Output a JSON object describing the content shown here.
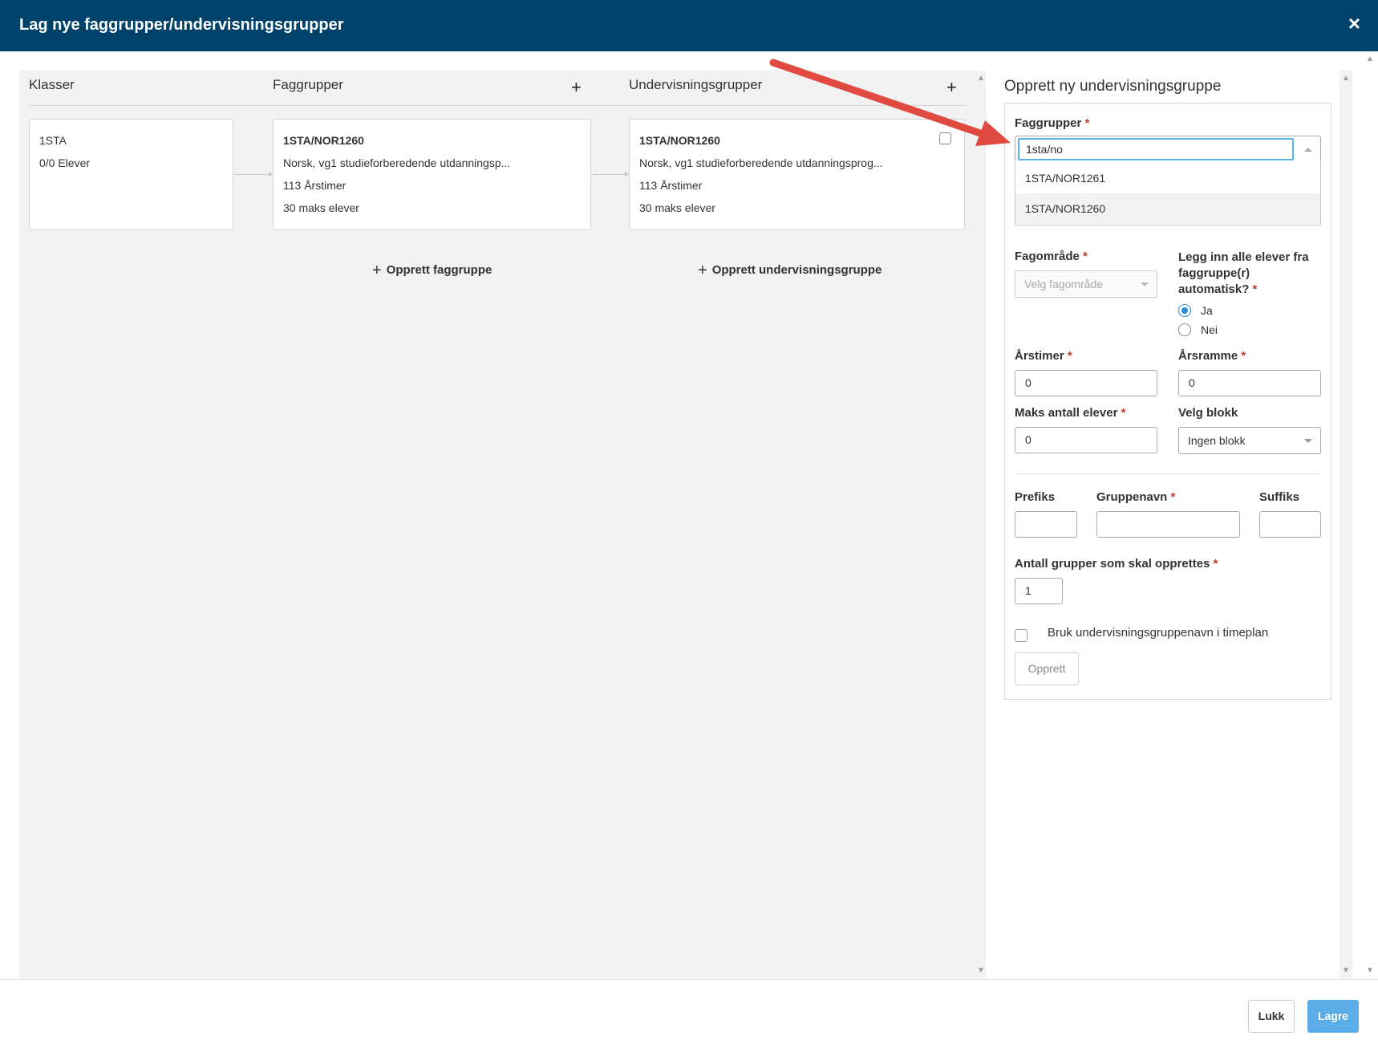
{
  "dialog": {
    "title": "Lag nye faggrupper/undervisningsgrupper",
    "close_label": "×"
  },
  "columns": {
    "klasser": {
      "header": "Klasser"
    },
    "faggrupper": {
      "header": "Faggrupper",
      "plus": "+"
    },
    "undervisningsgrupper": {
      "header": "Undervisningsgrupper",
      "plus": "+"
    }
  },
  "cards": {
    "klasse": {
      "name": "1STA",
      "elever": "0/0 Elever"
    },
    "faggruppe": {
      "code": "1STA/NOR1260",
      "description": "Norsk, vg1 studieforberedende utdanningsp...",
      "arstimer": "113 Årstimer",
      "maks": "30 maks elever"
    },
    "undervisningsgruppe": {
      "code": "1STA/NOR1260",
      "description": "Norsk, vg1 studieforberedende utdanningsprog...",
      "arstimer": "113 Årstimer",
      "maks": "30 maks elever"
    }
  },
  "actions": {
    "add_faggruppe": "Opprett faggruppe",
    "add_undervisningsgruppe": "Opprett undervisningsgruppe",
    "plus": "+"
  },
  "form": {
    "title": "Opprett ny undervisningsgruppe",
    "required_mark": "*",
    "faggrupper": {
      "label": "Faggrupper",
      "value": "1sta/no",
      "options": [
        "1STA/NOR1261",
        "1STA/NOR1260"
      ]
    },
    "fagomrade": {
      "label": "Fagområde",
      "placeholder": "Velg fagområde"
    },
    "legg_inn": {
      "label_line1": "Legg inn alle elever fra",
      "label_line2": "faggruppe(r)",
      "label_line3": "automatisk?",
      "option_yes": "Ja",
      "option_no": "Nei",
      "selected": "Ja"
    },
    "arstimer": {
      "label": "Årstimer",
      "value": "0"
    },
    "arsramme": {
      "label": "Årsramme",
      "value": "0"
    },
    "maks_elever": {
      "label": "Maks antall elever",
      "value": "0"
    },
    "velg_blokk": {
      "label": "Velg blokk",
      "value": "Ingen blokk"
    },
    "prefiks": {
      "label": "Prefiks",
      "value": ""
    },
    "gruppenavn": {
      "label": "Gruppenavn",
      "value": ""
    },
    "suffiks": {
      "label": "Suffiks",
      "value": ""
    },
    "antall_grupper": {
      "label": "Antall grupper som skal opprettes",
      "value": "1"
    },
    "bruk_navn": {
      "label": "Bruk undervisningsgruppenavn i timeplan",
      "checked": false
    },
    "submit": "Opprett"
  },
  "footer": {
    "close": "Lukk",
    "save": "Lagre"
  },
  "colors": {
    "header_bg": "#00426a",
    "save_button": "#5aade6",
    "annotation_arrow": "#e04a40",
    "radio_accent": "#2a8ad8"
  }
}
